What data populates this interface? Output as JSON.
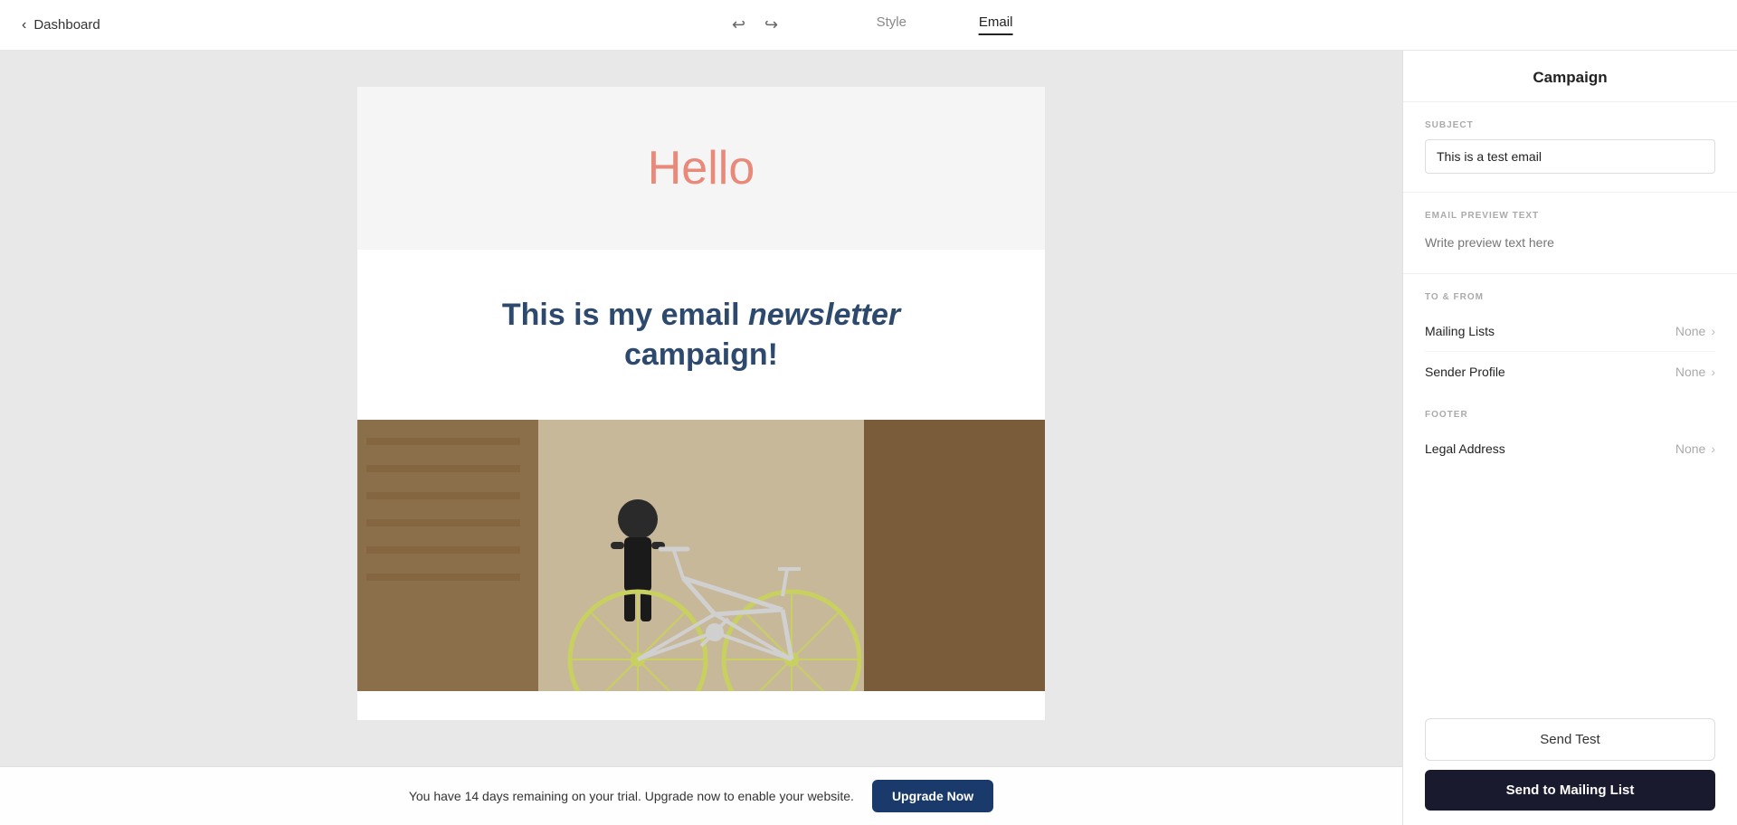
{
  "topbar": {
    "back_label": "Dashboard",
    "nav_style": "Style",
    "nav_email": "Email",
    "undo_icon": "↩",
    "redo_icon": "↪"
  },
  "canvas": {
    "hero_text": "Hello",
    "body_text_plain": "This is my email ",
    "body_text_em": "newsletter",
    "body_text_end": " campaign!"
  },
  "trial": {
    "message": "You have 14 days remaining on your trial. Upgrade now to enable your website.",
    "button_label": "Upgrade Now"
  },
  "panel": {
    "title": "Campaign",
    "subject_label": "SUBJECT",
    "subject_value": "This is a test email",
    "preview_label": "EMAIL PREVIEW TEXT",
    "preview_placeholder": "Write preview text here",
    "to_from_label": "TO & FROM",
    "mailing_lists_label": "Mailing Lists",
    "mailing_lists_value": "None",
    "sender_profile_label": "Sender Profile",
    "sender_profile_value": "None",
    "footer_label": "FOOTER",
    "legal_address_label": "Legal Address",
    "legal_address_value": "None",
    "send_test_label": "Send Test",
    "send_mailing_label": "Send to Mailing List"
  }
}
